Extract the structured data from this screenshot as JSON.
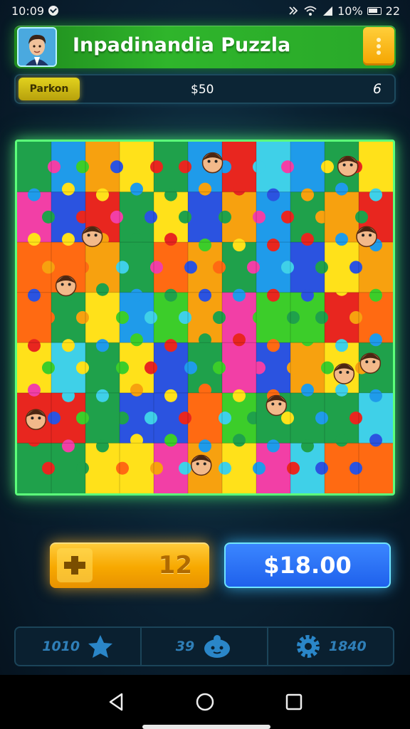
{
  "status_bar": {
    "time": "10:09",
    "battery_text": "10%",
    "right_text": "22"
  },
  "header": {
    "title": "Inpadinandia Puzzla",
    "avatar_icon": "player-avatar-icon",
    "menu_icon": "more-vertical-icon"
  },
  "info_bar": {
    "mode_label": "Parkon",
    "score": "$50",
    "counter": "6"
  },
  "board": {
    "rows": 7,
    "cols": 11,
    "piece_colors": [
      "#e8261f",
      "#f7a10f",
      "#ffe11a",
      "#3ccd2a",
      "#1fa14b",
      "#1f9bea",
      "#2b53e0",
      "#f23fa6",
      "#3fd0e8",
      "#ff6a12"
    ]
  },
  "actions": {
    "hint_icon": "plus-icon",
    "hint_count": "12",
    "buy_price": "$18.00"
  },
  "stats": [
    {
      "value": "1010",
      "icon": "star-icon"
    },
    {
      "value": "39",
      "icon": "character-icon"
    },
    {
      "value": "1840",
      "icon": "settings-gear-icon"
    }
  ],
  "colors": {
    "header_green": "#2fb52b",
    "board_glow": "#5cff7a",
    "hint_orange": "#f7a800",
    "buy_blue": "#1f61ec"
  }
}
